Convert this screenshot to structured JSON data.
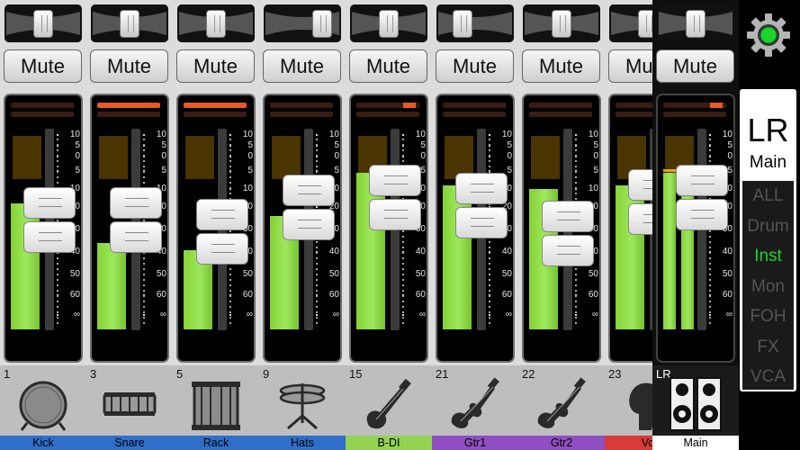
{
  "scale": {
    "labels": [
      "10",
      "5",
      "0",
      "5",
      "10",
      "20",
      "30",
      "40",
      "50",
      "60",
      "∞"
    ]
  },
  "channels": [
    {
      "number": "1",
      "name": "Kick",
      "mute_label": "Mute",
      "icon": "kick-drum-icon",
      "color": "#2f6fc9",
      "pan": 0.5,
      "fader_level": 0.55,
      "meter_level": 0.7,
      "clip": false
    },
    {
      "number": "3",
      "name": "Snare",
      "mute_label": "Mute",
      "icon": "snare-drum-icon",
      "color": "#2f6fc9",
      "pan": 0.5,
      "fader_level": 0.55,
      "meter_level": 0.48,
      "clip": true
    },
    {
      "number": "5",
      "name": "Rack",
      "mute_label": "Mute",
      "icon": "rack-tom-icon",
      "color": "#2f6fc9",
      "pan": 0.5,
      "fader_level": 0.49,
      "meter_level": 0.44,
      "clip": true
    },
    {
      "number": "9",
      "name": "Hats",
      "mute_label": "Mute",
      "icon": "hi-hat-icon",
      "color": "#2f6fc9",
      "pan": 0.85,
      "fader_level": 0.61,
      "meter_level": 0.63,
      "clip": false
    },
    {
      "number": "15",
      "name": "B-DI",
      "mute_label": "Mute",
      "icon": "bass-guitar-icon",
      "color": "#93d252",
      "pan": 0.5,
      "fader_level": 0.66,
      "meter_level": 0.87,
      "clip": false
    },
    {
      "number": "21",
      "name": "Gtr1",
      "mute_label": "Mute",
      "icon": "electric-guitar-icon",
      "color": "#8f4fc2",
      "pan": 0.28,
      "fader_level": 0.62,
      "meter_level": 0.8,
      "clip": false
    },
    {
      "number": "22",
      "name": "Gtr2",
      "mute_label": "Mute",
      "icon": "electric-guitar-icon",
      "color": "#8f4fc2",
      "pan": 0.5,
      "fader_level": 0.48,
      "meter_level": 0.78,
      "clip": false
    },
    {
      "number": "23",
      "name": "Vo",
      "mute_label": "Mute",
      "icon": "vocal-icon",
      "color": "#d93a3a",
      "pan": 0.5,
      "fader_level": 0.64,
      "meter_level": 0.8,
      "clip": false
    }
  ],
  "main": {
    "number": "LR",
    "name": "Main",
    "mute_label": "Mute",
    "icon": "stereo-speakers-icon",
    "pan": 0.5,
    "fader_level": 0.66,
    "meter_level": 0.87
  },
  "panel": {
    "title": "LR",
    "subtitle": "Main",
    "filters": [
      "ALL",
      "Drum",
      "Inst",
      "Mon",
      "FOH",
      "FX",
      "VCA"
    ],
    "selected_filter": "Inst",
    "status_color": "#1bd42d"
  }
}
